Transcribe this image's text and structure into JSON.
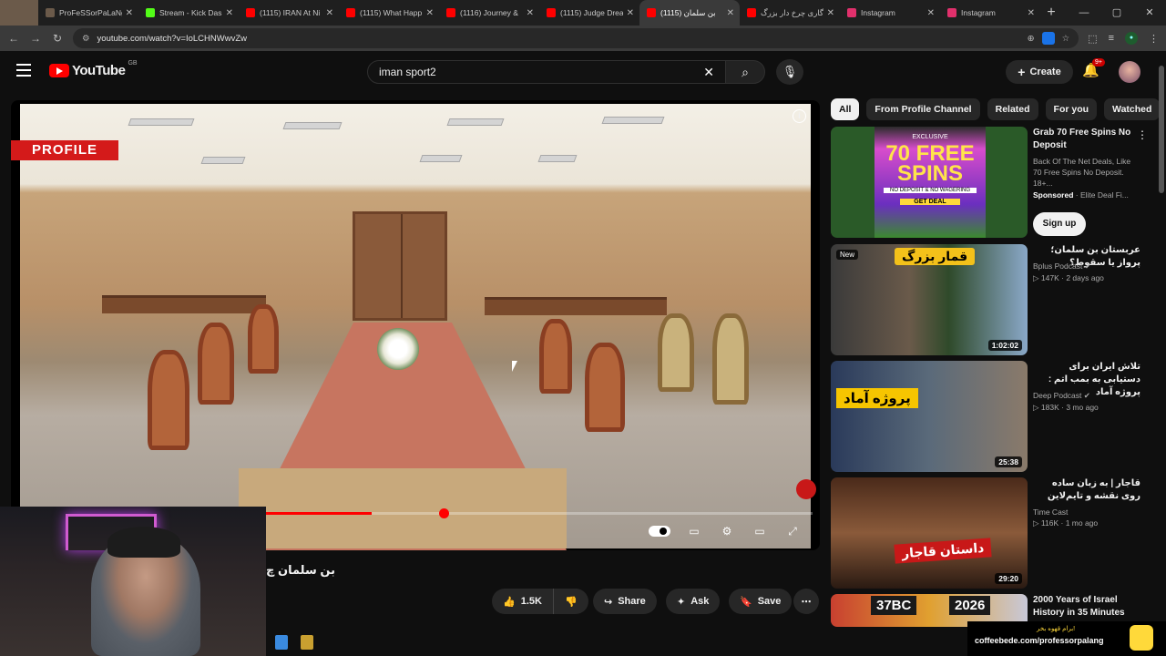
{
  "browser": {
    "tabs": [
      {
        "label": "ProFeSSorPaLaNg",
        "color": "#6b5a4a"
      },
      {
        "label": "Stream - Kick Das",
        "color": "#53fc18"
      },
      {
        "label": "(1115) IRAN At Ni",
        "color": "#ff0000"
      },
      {
        "label": "(1115) What Happ",
        "color": "#ff0000"
      },
      {
        "label": "(1116) Journey &",
        "color": "#ff0000"
      },
      {
        "label": "(1115) Judge Drea",
        "color": "#ff0000"
      },
      {
        "label": "(1115) بن سلمان",
        "color": "#ff0000"
      },
      {
        "label": "گاری چرخ دار بزرگ",
        "color": "#ff0000"
      },
      {
        "label": "Instagram",
        "color": "#e1306c"
      },
      {
        "label": "Instagram",
        "color": "#e1306c"
      }
    ],
    "url": "youtube.com/watch?v=IoLCHNWwvZw"
  },
  "youtube": {
    "logo": "YouTube",
    "country": "GB",
    "search_query": "iman sport2",
    "create_label": "Create",
    "notif_count": "9+"
  },
  "player": {
    "brand_logo": "PROFILE",
    "progress": 0.55
  },
  "video": {
    "title": "بن سلمان چ",
    "likes": "1.5K",
    "share": "Share",
    "ask": "Ask",
    "save": "Save"
  },
  "chips": [
    "All",
    "From Profile Channel",
    "Related",
    "For you",
    "Watched"
  ],
  "ad": {
    "title": "Grab 70 Free Spins No Deposit",
    "desc": "Back Of The Net Deals, Like 70 Free Spins No Deposit. 18+...",
    "sponsored": "Sponsored",
    "advertiser": "· Elite Deal Fi...",
    "cta": "Sign up",
    "img_top": "EXCLUSIVE",
    "img_big": "70 FREE SPINS",
    "img_sub": "NO DEPOSIT & NO WAGERING",
    "img_btn": "GET DEAL"
  },
  "recs": [
    {
      "title": "عربستان بن سلمان؛ پرواز یا سقوط؟",
      "channel": "Bplus Podcast",
      "stats": "147K · 2 days ago",
      "duration": "1:02:02",
      "badge": "New",
      "overlay": "قمار بزرگ"
    },
    {
      "title": "تلاش ایران برای دستیابی به بمب اتم : پروژه آماد",
      "channel": "Deep Podcast",
      "stats": "183K · 3 mo ago",
      "duration": "25:38",
      "overlay": "پروژه آماد"
    },
    {
      "title": "قاجار | به زبان ساده روی نقشه و تایم‌لاین",
      "channel": "Time Cast",
      "stats": "116K · 1 mo ago",
      "duration": "29:20",
      "overlay": "داستان قاجار"
    },
    {
      "title": "2000 Years of Israel History in 35 Minutes",
      "overlay_left": "37BC",
      "overlay_right": "2026"
    }
  ],
  "promo": {
    "line1": "برام قهوه بخر!",
    "line2": "coffeebede.com/professorpalang"
  }
}
